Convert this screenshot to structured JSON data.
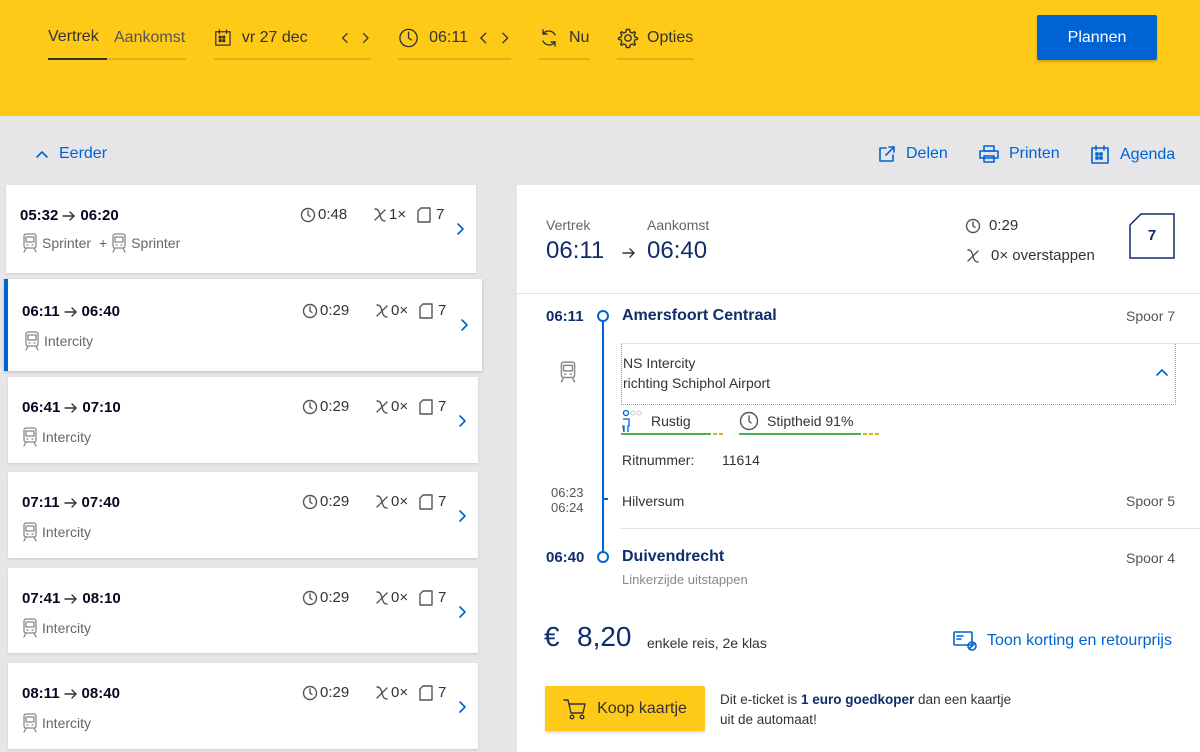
{
  "header": {
    "tab_vertrek": "Vertrek",
    "tab_aankomst": "Aankomst",
    "date": "vr 27 dec",
    "time": "06:11",
    "now": "Nu",
    "options": "Opties",
    "plan_button": "Plannen"
  },
  "toolbar": {
    "earlier": "Eerder",
    "share": "Delen",
    "print": "Printen",
    "agenda": "Agenda"
  },
  "trips": [
    {
      "depart": "05:32",
      "arrive": "06:20",
      "duration": "0:48",
      "changes": "1×",
      "platform": "7",
      "train1": "Sprinter",
      "plus": "+",
      "train2": "Sprinter"
    },
    {
      "depart": "06:11",
      "arrive": "06:40",
      "duration": "0:29",
      "changes": "0×",
      "platform": "7",
      "train1": "Intercity"
    },
    {
      "depart": "06:41",
      "arrive": "07:10",
      "duration": "0:29",
      "changes": "0×",
      "platform": "7",
      "train1": "Intercity"
    },
    {
      "depart": "07:11",
      "arrive": "07:40",
      "duration": "0:29",
      "changes": "0×",
      "platform": "7",
      "train1": "Intercity"
    },
    {
      "depart": "07:41",
      "arrive": "08:10",
      "duration": "0:29",
      "changes": "0×",
      "platform": "7",
      "train1": "Intercity"
    },
    {
      "depart": "08:11",
      "arrive": "08:40",
      "duration": "0:29",
      "changes": "0×",
      "platform": "7",
      "train1": "Intercity"
    }
  ],
  "selected_trip_index": 1,
  "detail": {
    "vertrek_label": "Vertrek",
    "aankomst_label": "Aankomst",
    "depart": "06:11",
    "arrive": "06:40",
    "duration": "0:29",
    "changes": "0× overstappen",
    "platform_badge": "7",
    "from_time": "06:11",
    "from_station": "Amersfoort Centraal",
    "from_platform": "Spoor 7",
    "train_operator": "NS Intercity",
    "train_direction": "richting Schiphol Airport",
    "crowding": "Rustig",
    "punctuality": "Stiptheid 91%",
    "ritnummer_label": "Ritnummer:",
    "ritnummer": "11614",
    "via_arrive": "06:23",
    "via_depart": "06:24",
    "via_station": "Hilversum",
    "via_platform": "Spoor 5",
    "to_time": "06:40",
    "to_station": "Duivendrecht",
    "to_platform": "Spoor 4",
    "exit_side": "Linkerzijde uitstappen",
    "price_currency": "€",
    "price": "8,20",
    "price_note": "enkele reis, 2e klas",
    "discount_link": "Toon korting en retourprijs",
    "buy_button": "Koop kaartje",
    "eticket_pre": "Dit e-ticket is ",
    "eticket_bold": "1 euro goedkoper",
    "eticket_post": " dan een kaartje",
    "eticket_line2": "uit de automaat!"
  },
  "colors": {
    "brand_yellow": "#ffc917",
    "ns_blue": "#0063d3",
    "navy": "#0f2d6b",
    "background": "#e6e6e9"
  }
}
